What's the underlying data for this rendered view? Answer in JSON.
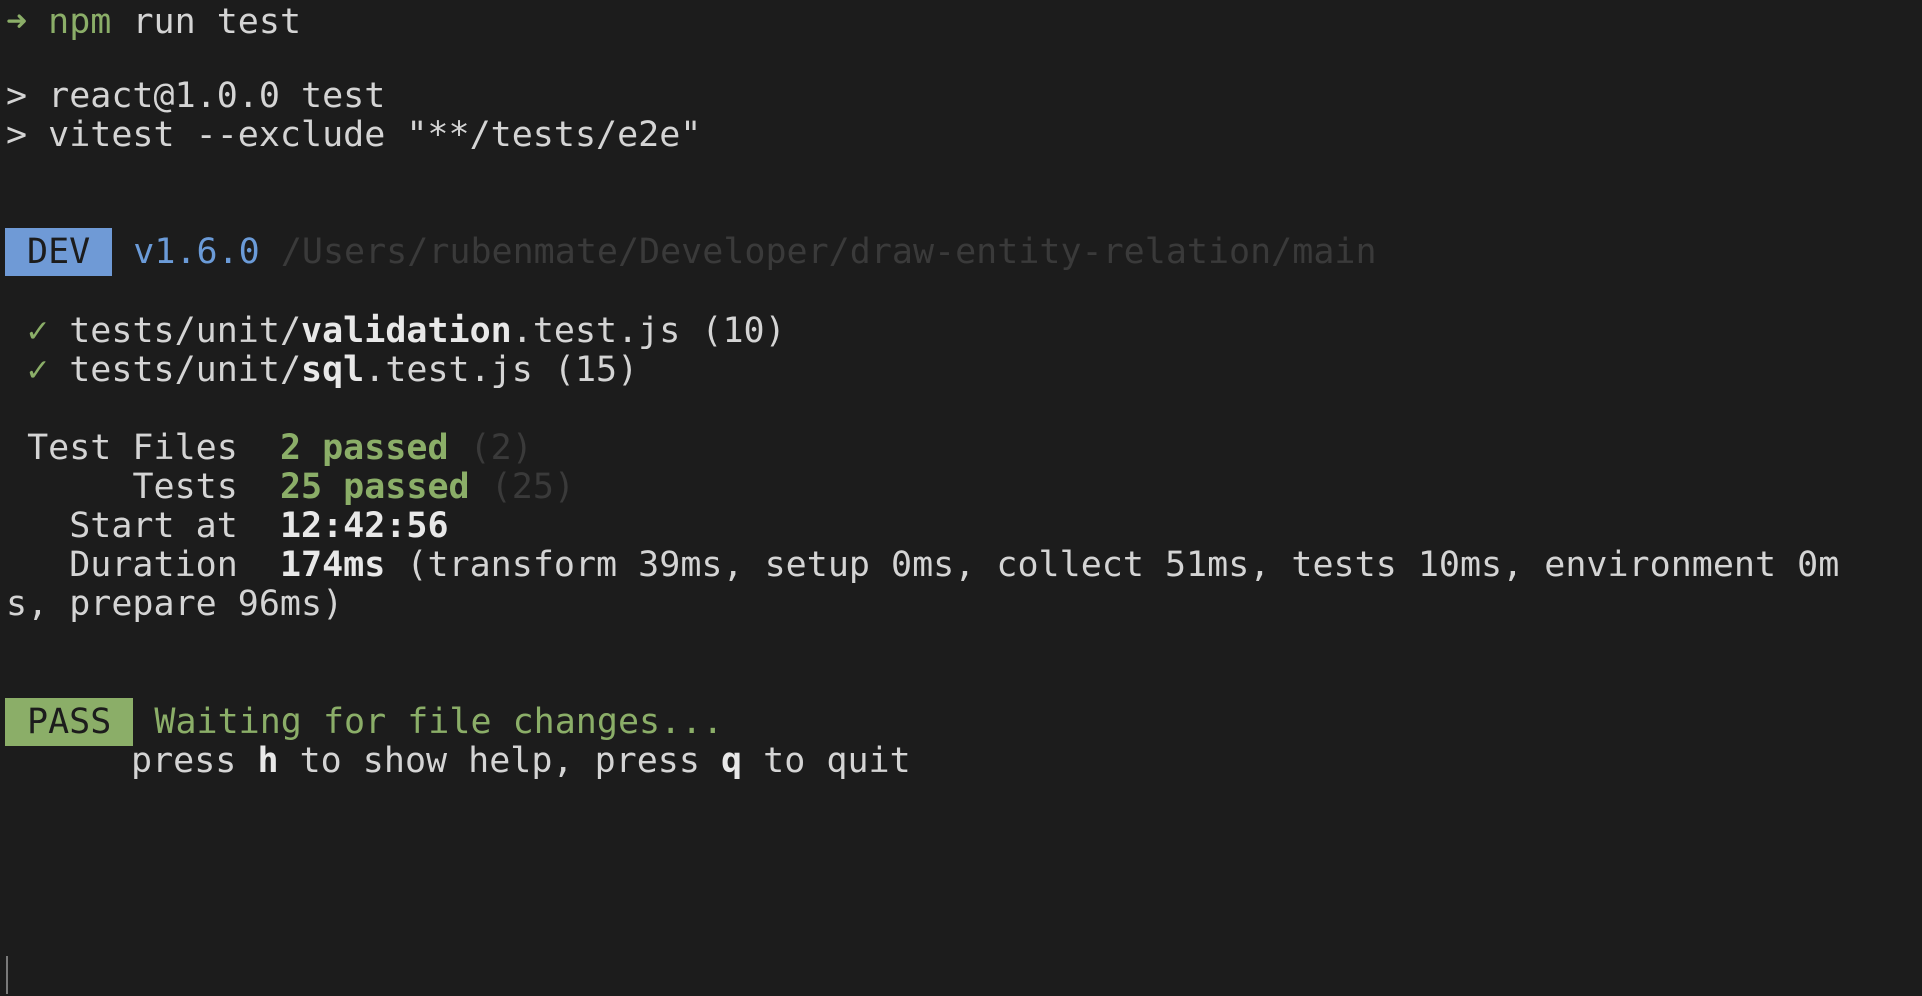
{
  "prompt": {
    "arrow": "➜",
    "cmd": "npm",
    "args": " run test"
  },
  "script_lines": [
    "> react@1.0.0 test",
    "> vitest --exclude \"**/tests/e2e\""
  ],
  "dev_header": {
    "badge": "DEV",
    "version": "v1.6.0",
    "path": "/Users/rubenmate/Developer/draw-entity-relation/main"
  },
  "test_files": [
    {
      "check": "✓",
      "prefix": "tests/unit/",
      "name": "validation",
      "suffix": ".test.js",
      "count": "(10)"
    },
    {
      "check": "✓",
      "prefix": "tests/unit/",
      "name": "sql",
      "suffix": ".test.js",
      "count": "(15)"
    }
  ],
  "summary": {
    "test_files_label": "Test Files",
    "test_files_passed": "2 passed",
    "test_files_total": "(2)",
    "tests_label": "Tests",
    "tests_passed": "25 passed",
    "tests_total": "(25)",
    "start_label": "Start at",
    "start_value": "12:42:56",
    "duration_label": "Duration",
    "duration_value": "174ms",
    "duration_detail_1": "(transform 39ms, setup 0ms, collect 51ms, tests 10ms, environment 0m",
    "duration_detail_2": "s, prepare 96ms)"
  },
  "status": {
    "badge": "PASS",
    "message": "Waiting for file changes...",
    "help_pre": "press ",
    "help_key_h": "h",
    "help_mid": " to show help, press ",
    "help_key_q": "q",
    "help_post": " to quit"
  },
  "colors": {
    "background": "#1c1c1c",
    "text": "#d4d4d4",
    "green": "#8bae68",
    "blue": "#6b9bd8",
    "dim": "#3a3a3a"
  }
}
